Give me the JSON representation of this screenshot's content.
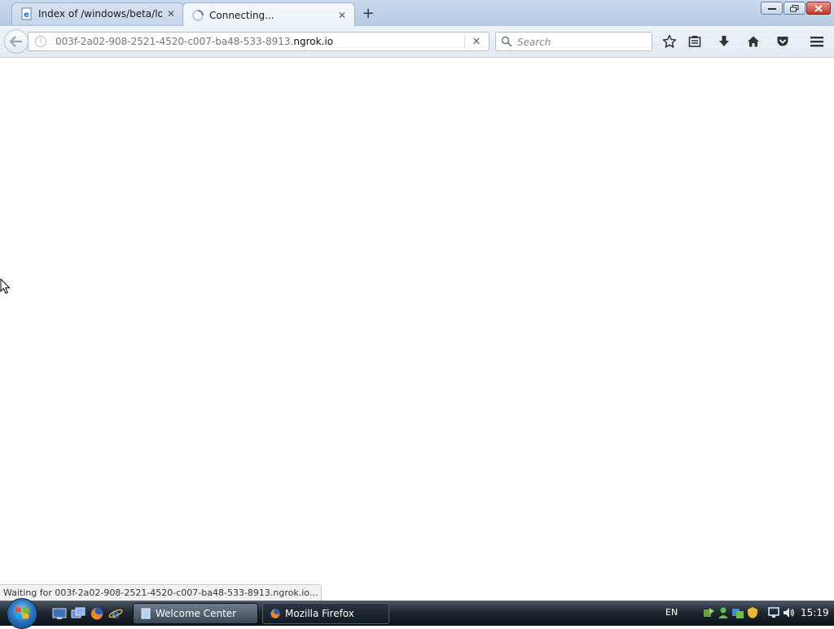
{
  "browser": {
    "tabs": [
      {
        "title": "Index of /windows/beta/lo...",
        "active": false
      },
      {
        "title": "Connecting...",
        "active": true
      }
    ],
    "new_tab_label": "+",
    "url_prefix": "003f-2a02-908-2521-4520-c007-ba48-533-8913.",
    "url_host": "ngrok.io",
    "search_placeholder": "Search",
    "status_text": "Waiting for 003f-2a02-908-2521-4520-c007-ba48-533-8913.ngrok.io..."
  },
  "toolbar_icons": [
    "bookmark-star-icon",
    "reading-list-icon",
    "download-icon",
    "home-icon",
    "pocket-icon",
    "menu-icon"
  ],
  "taskbar": {
    "buttons": [
      {
        "label": "Welcome Center",
        "icon": "welcome-center-icon"
      },
      {
        "label": "Mozilla Firefox",
        "icon": "firefox-icon"
      }
    ],
    "language": "EN",
    "clock": "15:19"
  },
  "colors": {
    "tabstrip": "#c9d9ee",
    "taskbar": "#1f2730",
    "accent": "#2f78c4"
  }
}
